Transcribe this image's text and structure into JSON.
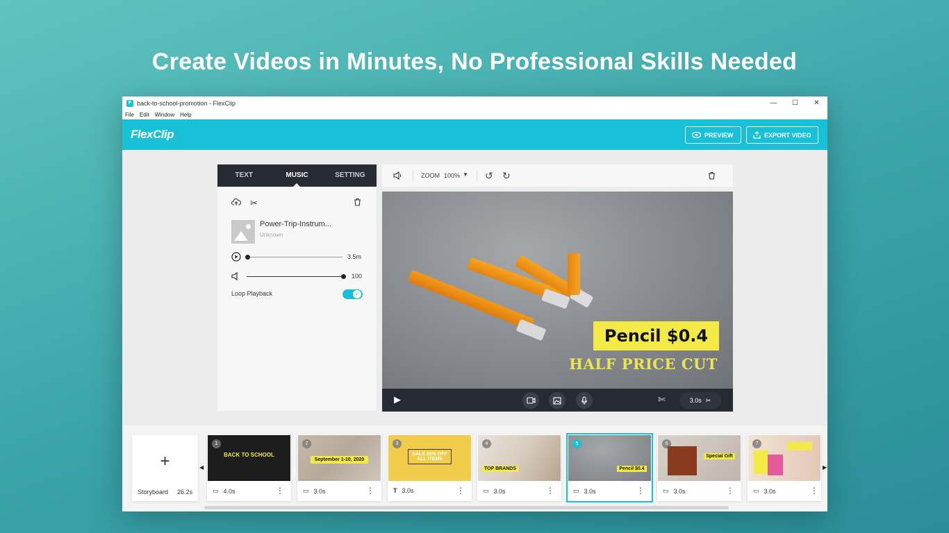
{
  "hero": {
    "title": "Create Videos in Minutes, No Professional Skills Needed"
  },
  "window": {
    "title": "back-to-school-promotion - FlexClip",
    "menu": [
      "File",
      "Edit",
      "Window",
      "Help"
    ]
  },
  "appbar": {
    "logo": "FlexClip",
    "preview": "PREVIEW",
    "export": "EXPORT VIDEO"
  },
  "panel": {
    "tabs": [
      "TEXT",
      "MUSIC",
      "SETTING"
    ],
    "music": {
      "name": "Power-Trip-Instrum...",
      "artist": "Unknown",
      "duration": "3.5m",
      "volume": "100"
    },
    "loop_label": "Loop Playback"
  },
  "toolbar": {
    "zoom_label": "ZOOM",
    "zoom_value": "100%"
  },
  "canvas": {
    "price": "Pencil $0.4",
    "sale": "HALF PRICE CUT"
  },
  "player": {
    "duration": "3.0s"
  },
  "timeline": {
    "storyboard_label": "Storyboard",
    "storyboard_duration": "26.2s",
    "clips": [
      {
        "num": "1",
        "duration": "4.0s",
        "caption": "BACK TO SCHOOL"
      },
      {
        "num": "2",
        "duration": "3.0s",
        "caption": "September 1-10, 2020"
      },
      {
        "num": "3",
        "duration": "3.0s",
        "caption": "SALE 25% OFF ALL ITEMS"
      },
      {
        "num": "4",
        "duration": "3.0s",
        "caption": "TOP BRANDS"
      },
      {
        "num": "5",
        "duration": "3.0s",
        "caption": "Pencil $0.4"
      },
      {
        "num": "6",
        "duration": "3.0s",
        "caption": "Special Gift"
      },
      {
        "num": "7",
        "duration": "3.0s",
        "caption": ""
      }
    ]
  },
  "colors": {
    "accent": "#19c1d8",
    "dark": "#252a33",
    "highlight": "#f3ea45"
  }
}
